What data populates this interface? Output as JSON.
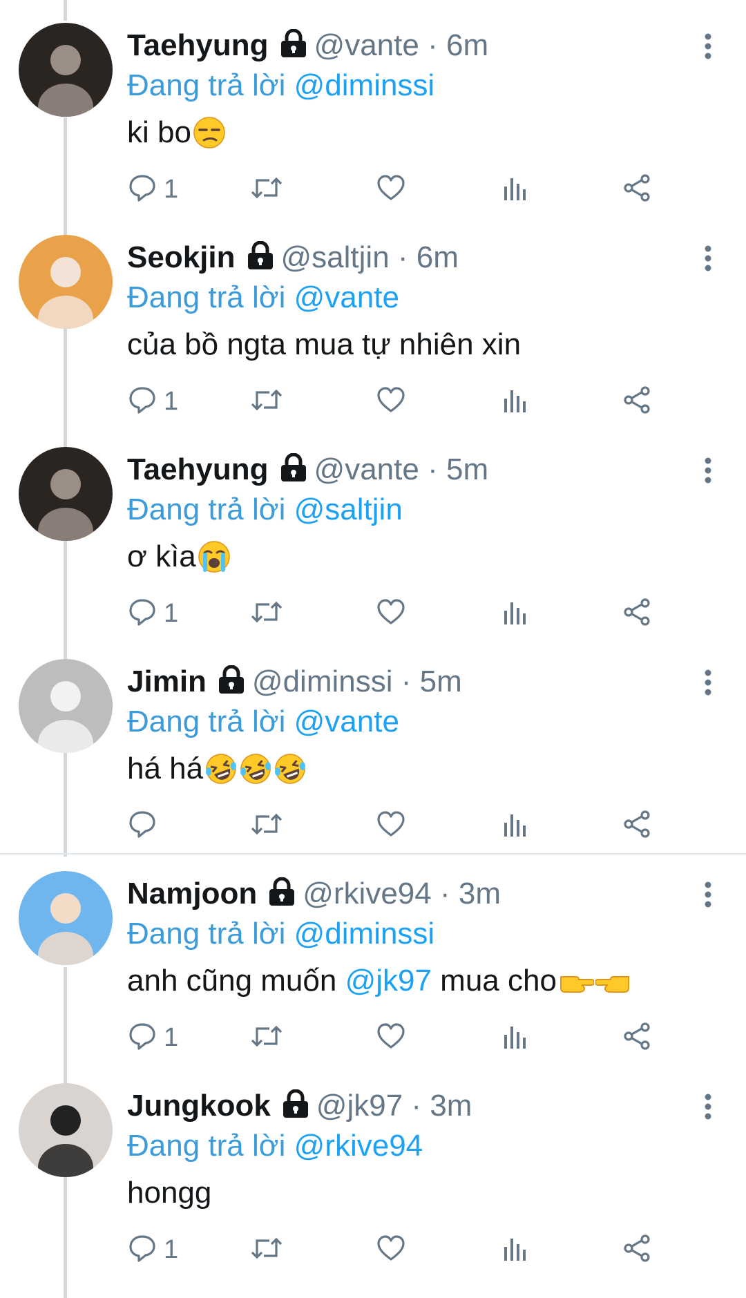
{
  "tweets": [
    {
      "name": "Taehyung",
      "handle": "@vante",
      "dot": "·",
      "time": "6m",
      "reply_prefix": "Đang trả lời",
      "reply_to": "@diminssi",
      "body_before": "ki bo",
      "mention": "",
      "body_after": "",
      "emoji": [
        "unamused-face"
      ],
      "reply_count": "1",
      "avatar": {
        "bg": "#2b2522",
        "accent": "#9a8e86"
      }
    },
    {
      "name": "Seokjin",
      "handle": "@saltjin",
      "dot": "·",
      "time": "6m",
      "reply_prefix": "Đang trả lời",
      "reply_to": "@vante",
      "body_before": "của bồ ngta mua tự nhiên xin",
      "mention": "",
      "body_after": "",
      "emoji": [],
      "reply_count": "1",
      "avatar": {
        "bg": "#e9a24a",
        "accent": "#f3e2d6"
      }
    },
    {
      "name": "Taehyung",
      "handle": "@vante",
      "dot": "·",
      "time": "5m",
      "reply_prefix": "Đang trả lời",
      "reply_to": "@saltjin",
      "body_before": "ơ kìa",
      "mention": "",
      "body_after": "",
      "emoji": [
        "crying-face"
      ],
      "reply_count": "1",
      "avatar": {
        "bg": "#2b2522",
        "accent": "#9a8e86"
      }
    },
    {
      "name": "Jimin",
      "handle": "@diminssi",
      "dot": "·",
      "time": "5m",
      "reply_prefix": "Đang trả lời",
      "reply_to": "@vante",
      "body_before": "há há",
      "mention": "",
      "body_after": "",
      "emoji": [
        "laughing-face",
        "laughing-face",
        "laughing-face"
      ],
      "reply_count": "",
      "avatar": {
        "bg": "#bdbdbd",
        "accent": "#f2f2f2"
      }
    },
    {
      "name": "Namjoon",
      "handle": "@rkive94",
      "dot": "·",
      "time": "3m",
      "reply_prefix": "Đang trả lời",
      "reply_to": "@diminssi",
      "body_before": "anh cũng muốn ",
      "mention": "@jk97",
      "body_after": " mua cho",
      "emoji": [
        "pointing-right",
        "pointing-left"
      ],
      "reply_count": "1",
      "avatar": {
        "bg": "#6fb6ee",
        "accent": "#f2dcc8"
      }
    },
    {
      "name": "Jungkook",
      "handle": "@jk97",
      "dot": "·",
      "time": "3m",
      "reply_prefix": "Đang trả lời",
      "reply_to": "@rkive94",
      "body_before": "hongg",
      "mention": "",
      "body_after": "",
      "emoji": [],
      "reply_count": "1",
      "avatar": {
        "bg": "#d9d4cf",
        "accent": "#222222"
      }
    }
  ],
  "colors": {
    "link": "#1da1f2",
    "secondary_text": "#657786",
    "thread_line": "#d3d8dc",
    "divider": "#e1e8ed",
    "icon": "#657786"
  },
  "icons": {
    "lock": "lock-icon",
    "more": "more-vertical-icon",
    "reply": "reply-icon",
    "retweet": "retweet-icon",
    "like": "heart-icon",
    "analytics": "analytics-icon",
    "share": "share-icon"
  }
}
